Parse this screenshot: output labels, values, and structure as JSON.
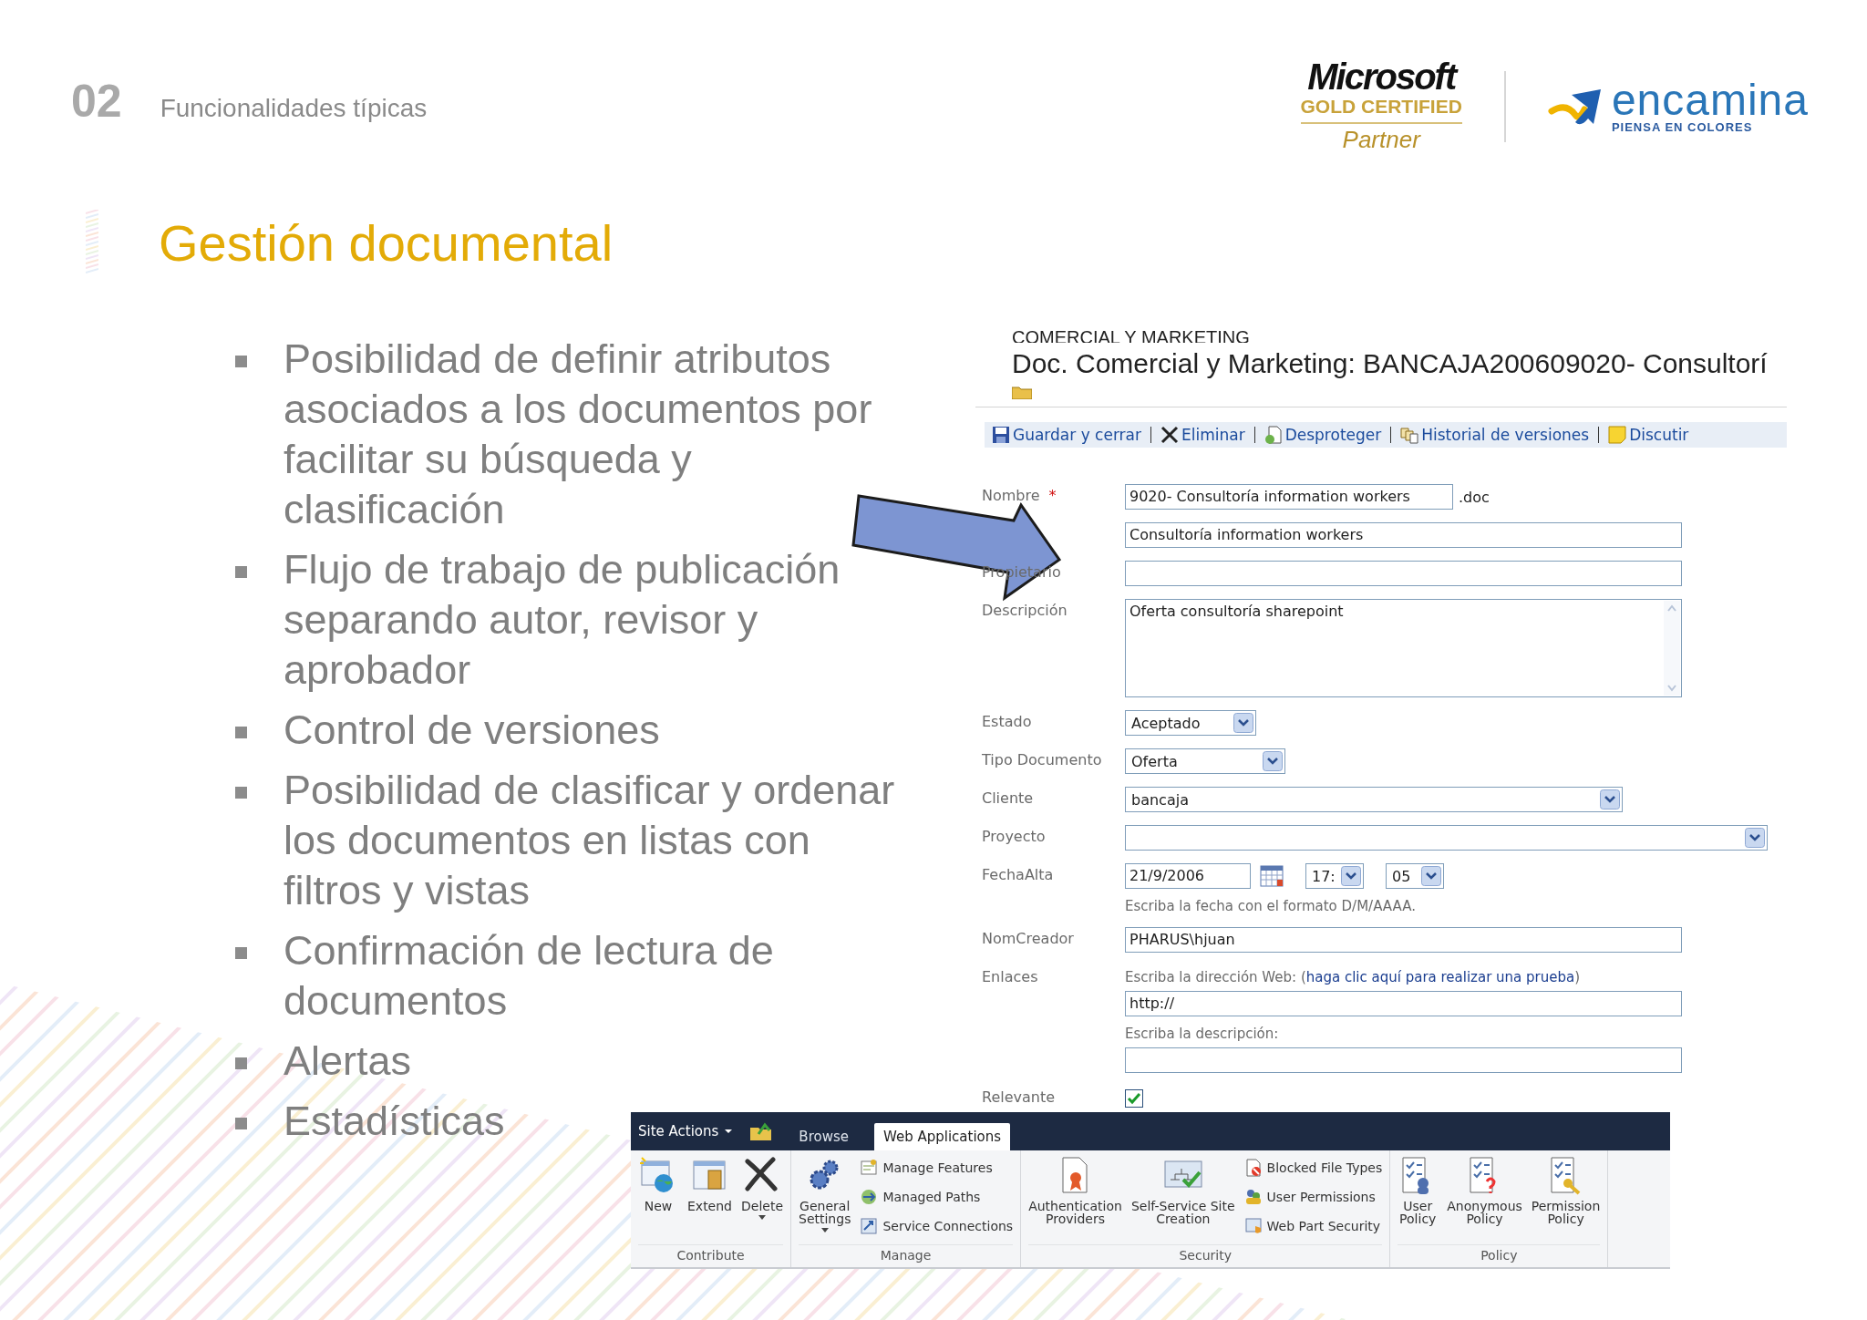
{
  "slide": {
    "number": "02",
    "section": "Funcionalidades típicas",
    "title": "Gestión documental"
  },
  "partner_logo": {
    "brand": "Microsoft",
    "level": "GOLD CERTIFIED",
    "role": "Partner"
  },
  "company_logo": {
    "name": "encamina",
    "tagline": "PIENSA EN COLORES"
  },
  "bullets": [
    "Posibilidad de definir atributos asociados a los documentos por facilitar su búsqueda y clasificación",
    "Flujo de trabajo de publicación separando autor, revisor y aprobador",
    "Control de versiones",
    "Posibilidad de clasificar y ordenar los documentos en listas con filtros y vistas",
    "Confirmación de lectura de documentos",
    "Alertas",
    "Estadísticas"
  ],
  "form": {
    "breadcrumb": "COMERCIAL Y MARKETING",
    "title": "Doc. Comercial y Marketing: BANCAJA200609020- Consultorí",
    "toolbar": [
      {
        "label": "Guardar y cerrar"
      },
      {
        "label": "Eliminar"
      },
      {
        "label": "Desproteger"
      },
      {
        "label": "Historial de versiones"
      },
      {
        "label": "Discutir"
      }
    ],
    "fields": [
      {
        "kind": "text",
        "label": "Nombre",
        "marker": "*",
        "value": "9020- Consultoría information workers",
        "suffix": ".doc"
      },
      {
        "kind": "text",
        "value": "Consultoría information workers"
      },
      {
        "kind": "text",
        "label": "Propietario"
      },
      {
        "kind": "textarea",
        "label": "Descripción",
        "value": "Oferta consultoría sharepoint"
      },
      {
        "kind": "select",
        "label": "Estado",
        "value": "Aceptado"
      },
      {
        "kind": "select",
        "label": "Tipo Documento",
        "value": "Oferta"
      },
      {
        "kind": "select",
        "label": "Cliente",
        "value": "bancaja"
      },
      {
        "kind": "select",
        "label": "Proyecto"
      },
      {
        "kind": "date",
        "label": "FechaAlta",
        "value": "21/9/2006",
        "hour": "17:",
        "minute": "05",
        "hint": "Escriba la fecha con el formato D/M/AAAA."
      },
      {
        "kind": "text",
        "label": "NomCreador",
        "value": "PHARUS\\hjuan"
      },
      {
        "kind": "url",
        "label": "Enlaces",
        "prompt": "Escriba la dirección Web: (",
        "link": "haga clic aquí para realizar una prueba",
        "prompt_end": ")",
        "value": "http://",
        "description_prompt": "Escriba la descripción:"
      },
      {
        "kind": "checkbox",
        "label": "Relevante",
        "checked": true
      }
    ]
  },
  "ribbon": {
    "site_actions": "Site Actions",
    "tabs": [
      {
        "label": "Browse",
        "selected": false
      },
      {
        "label": "Web Applications",
        "selected": true
      }
    ],
    "groups": [
      {
        "name": "Contribute",
        "items": [
          {
            "kind": "large",
            "label": "New"
          },
          {
            "kind": "large",
            "label": "Extend"
          },
          {
            "kind": "large",
            "label": "Delete",
            "dropdown": true
          }
        ]
      },
      {
        "name": "Manage",
        "items": [
          {
            "kind": "large",
            "label": "General\nSettings",
            "dropdown": true
          },
          {
            "kind": "small",
            "label": "Manage Features"
          },
          {
            "kind": "small",
            "label": "Managed Paths"
          },
          {
            "kind": "small",
            "label": "Service Connections"
          }
        ]
      },
      {
        "name": "Security",
        "items": [
          {
            "kind": "large",
            "label": "Authentication\nProviders"
          },
          {
            "kind": "large",
            "label": "Self-Service Site\nCreation"
          },
          {
            "kind": "small",
            "label": "Blocked File Types"
          },
          {
            "kind": "small",
            "label": "User Permissions"
          },
          {
            "kind": "small",
            "label": "Web Part Security"
          }
        ]
      },
      {
        "name": "Policy",
        "items": [
          {
            "kind": "large",
            "label": "User\nPolicy"
          },
          {
            "kind": "large",
            "label": "Anonymous\nPolicy"
          },
          {
            "kind": "large",
            "label": "Permission\nPolicy"
          }
        ]
      }
    ]
  }
}
